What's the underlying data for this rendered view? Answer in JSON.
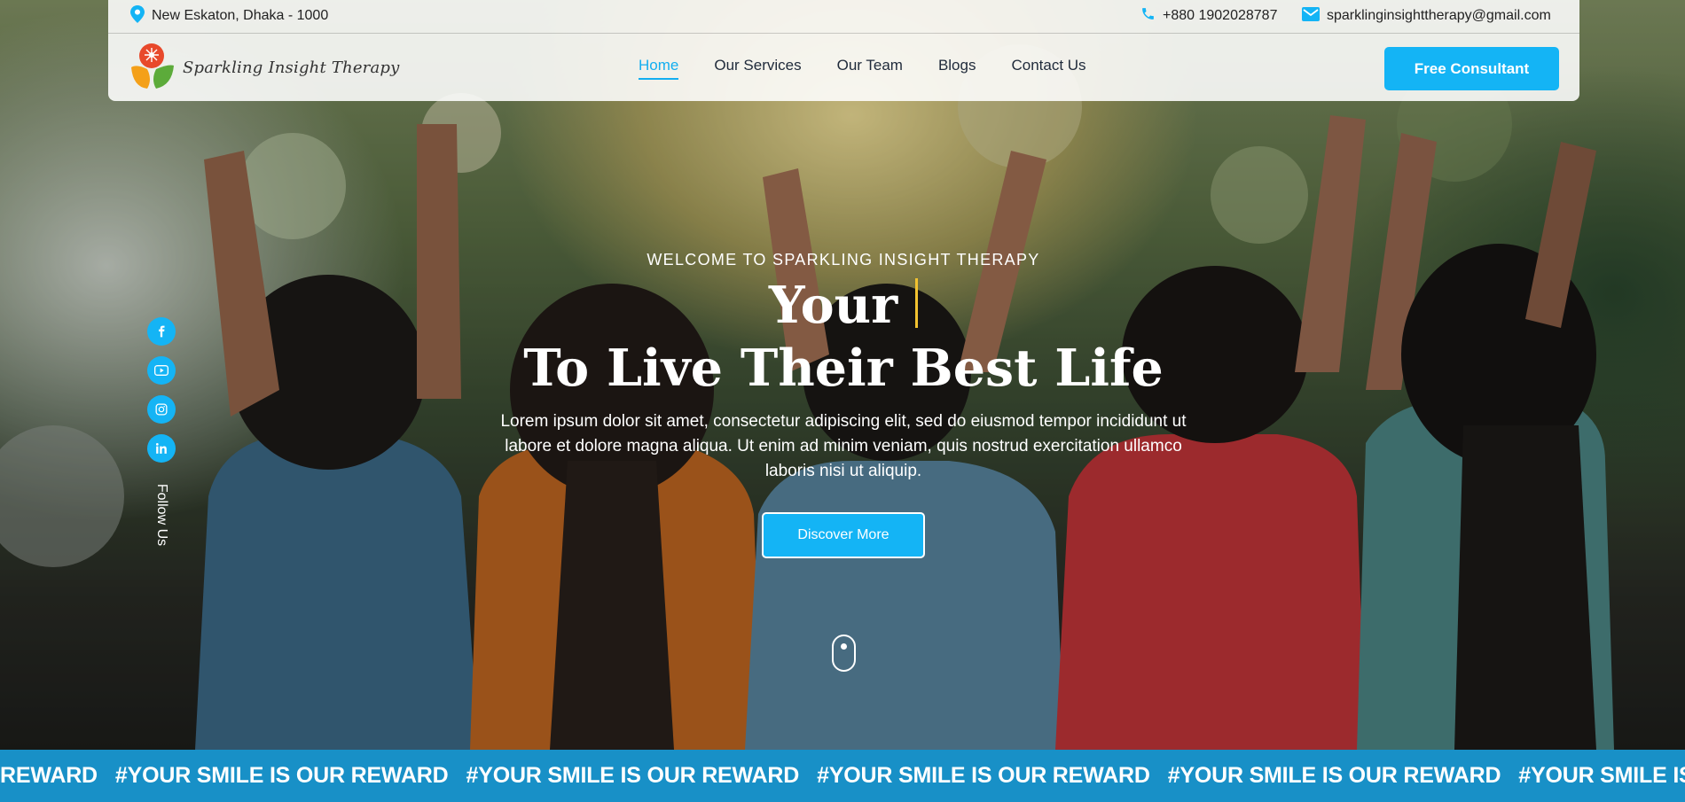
{
  "topbar": {
    "location": "New Eskaton, Dhaka - 1000",
    "phone": "+880 1902028787",
    "email": "sparklinginsighttherapy@gmail.com"
  },
  "logo": {
    "text": "Sparkling Insight Therapy"
  },
  "nav": {
    "items": [
      {
        "label": "Home",
        "active": true
      },
      {
        "label": "Our Services",
        "active": false
      },
      {
        "label": "Our Team",
        "active": false
      },
      {
        "label": "Blogs",
        "active": false
      },
      {
        "label": "Contact Us",
        "active": false
      }
    ],
    "cta": "Free Consultant"
  },
  "social": {
    "icons": [
      "facebook-icon",
      "youtube-icon",
      "instagram-icon",
      "linkedin-icon"
    ],
    "follow_label": "Follow Us"
  },
  "hero": {
    "eyebrow": "WELCOME TO SPARKLING INSIGHT THERAPY",
    "headline_1": "Your",
    "headline_2": "To Live Their Best Life",
    "description": "Lorem ipsum dolor sit amet, consectetur adipiscing elit, sed do eiusmod tempor incididunt ut labore et dolore magna aliqua. Ut enim ad minim veniam, quis nostrud exercitation ullamco laboris nisi ut aliquip.",
    "button": "Discover More"
  },
  "marquee": {
    "items": [
      "REWARD",
      "#YOUR SMILE IS OUR REWARD",
      "#YOUR SMILE IS OUR REWARD",
      "#YOUR SMILE IS OUR REWARD",
      "#YOUR SMILE IS OUR REWARD",
      "#YOUR SMILE IS OUR REWARD"
    ]
  },
  "colors": {
    "accent": "#14b4f5",
    "marquee_bg": "#1890c7",
    "caret": "#f2c230",
    "logo_red": "#e8492b",
    "logo_orange": "#f4a019",
    "logo_green": "#5cab3a"
  }
}
